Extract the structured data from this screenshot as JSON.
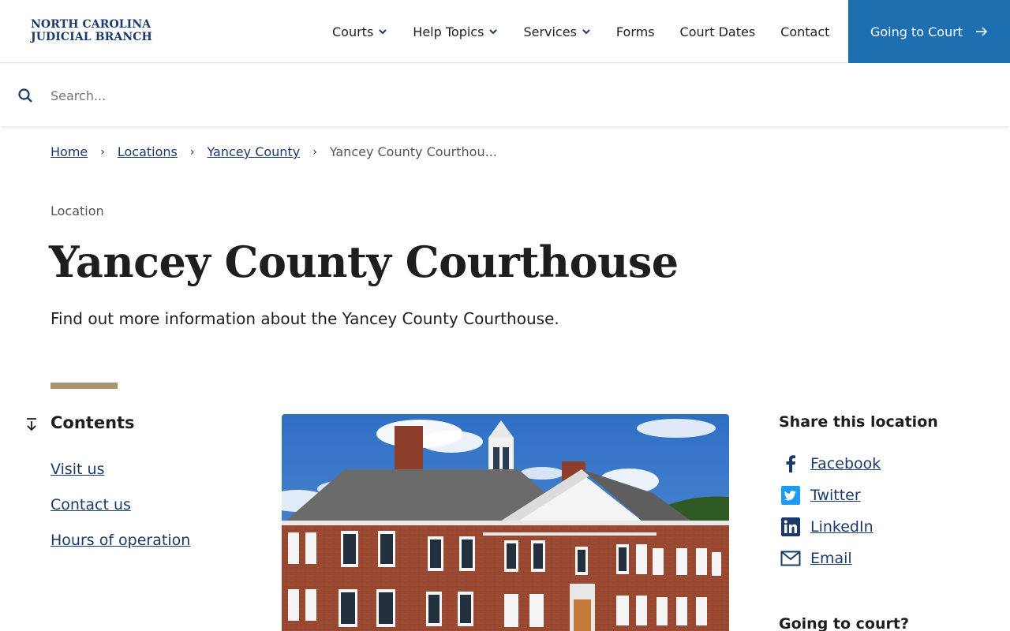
{
  "header": {
    "logo_line1": "NORTH CAROLINA",
    "logo_line2": "JUDICIAL BRANCH",
    "nav": [
      {
        "label": "Courts",
        "dropdown": true
      },
      {
        "label": "Help Topics",
        "dropdown": true
      },
      {
        "label": "Services",
        "dropdown": true
      },
      {
        "label": "Forms",
        "dropdown": false
      },
      {
        "label": "Court Dates",
        "dropdown": false
      },
      {
        "label": "Contact",
        "dropdown": false
      }
    ],
    "cta_label": "Going to Court",
    "cta_color": "#1d6fb0"
  },
  "search": {
    "placeholder": "Search...",
    "value": ""
  },
  "breadcrumb": {
    "items": [
      "Home",
      "Locations",
      "Yancey County"
    ],
    "current": "Yancey County Courthou..."
  },
  "hero": {
    "eyebrow": "Location",
    "title": "Yancey County Courthouse",
    "lede": "Find out more information about the Yancey County Courthouse.",
    "accent_color": "#a89470"
  },
  "contents": {
    "title": "Contents",
    "links": [
      "Visit us",
      "Contact us",
      "Hours of operation"
    ]
  },
  "share": {
    "title": "Share this location",
    "links": [
      {
        "label": "Facebook",
        "icon": "facebook-icon"
      },
      {
        "label": "Twitter",
        "icon": "twitter-icon"
      },
      {
        "label": "LinkedIn",
        "icon": "linkedin-icon"
      },
      {
        "label": "Email",
        "icon": "email-icon"
      }
    ],
    "next_heading": "Going to court?"
  },
  "colors": {
    "link": "#1b3a6b",
    "brand_navy": "#1b3a6b"
  }
}
